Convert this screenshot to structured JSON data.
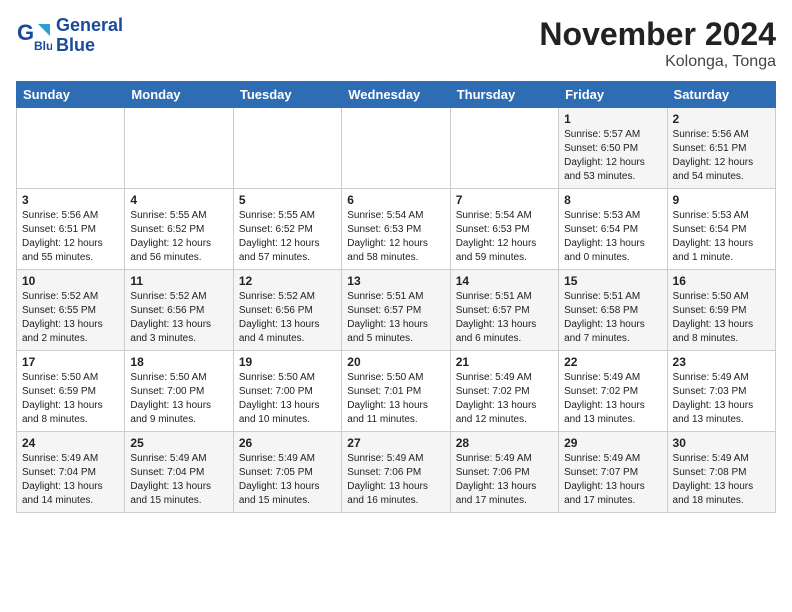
{
  "header": {
    "logo_line1": "General",
    "logo_line2": "Blue",
    "title": "November 2024",
    "subtitle": "Kolonga, Tonga"
  },
  "columns": [
    "Sunday",
    "Monday",
    "Tuesday",
    "Wednesday",
    "Thursday",
    "Friday",
    "Saturday"
  ],
  "rows": [
    [
      {
        "num": "",
        "info": ""
      },
      {
        "num": "",
        "info": ""
      },
      {
        "num": "",
        "info": ""
      },
      {
        "num": "",
        "info": ""
      },
      {
        "num": "",
        "info": ""
      },
      {
        "num": "1",
        "info": "Sunrise: 5:57 AM\nSunset: 6:50 PM\nDaylight: 12 hours and 53 minutes."
      },
      {
        "num": "2",
        "info": "Sunrise: 5:56 AM\nSunset: 6:51 PM\nDaylight: 12 hours and 54 minutes."
      }
    ],
    [
      {
        "num": "3",
        "info": "Sunrise: 5:56 AM\nSunset: 6:51 PM\nDaylight: 12 hours and 55 minutes."
      },
      {
        "num": "4",
        "info": "Sunrise: 5:55 AM\nSunset: 6:52 PM\nDaylight: 12 hours and 56 minutes."
      },
      {
        "num": "5",
        "info": "Sunrise: 5:55 AM\nSunset: 6:52 PM\nDaylight: 12 hours and 57 minutes."
      },
      {
        "num": "6",
        "info": "Sunrise: 5:54 AM\nSunset: 6:53 PM\nDaylight: 12 hours and 58 minutes."
      },
      {
        "num": "7",
        "info": "Sunrise: 5:54 AM\nSunset: 6:53 PM\nDaylight: 12 hours and 59 minutes."
      },
      {
        "num": "8",
        "info": "Sunrise: 5:53 AM\nSunset: 6:54 PM\nDaylight: 13 hours and 0 minutes."
      },
      {
        "num": "9",
        "info": "Sunrise: 5:53 AM\nSunset: 6:54 PM\nDaylight: 13 hours and 1 minute."
      }
    ],
    [
      {
        "num": "10",
        "info": "Sunrise: 5:52 AM\nSunset: 6:55 PM\nDaylight: 13 hours and 2 minutes."
      },
      {
        "num": "11",
        "info": "Sunrise: 5:52 AM\nSunset: 6:56 PM\nDaylight: 13 hours and 3 minutes."
      },
      {
        "num": "12",
        "info": "Sunrise: 5:52 AM\nSunset: 6:56 PM\nDaylight: 13 hours and 4 minutes."
      },
      {
        "num": "13",
        "info": "Sunrise: 5:51 AM\nSunset: 6:57 PM\nDaylight: 13 hours and 5 minutes."
      },
      {
        "num": "14",
        "info": "Sunrise: 5:51 AM\nSunset: 6:57 PM\nDaylight: 13 hours and 6 minutes."
      },
      {
        "num": "15",
        "info": "Sunrise: 5:51 AM\nSunset: 6:58 PM\nDaylight: 13 hours and 7 minutes."
      },
      {
        "num": "16",
        "info": "Sunrise: 5:50 AM\nSunset: 6:59 PM\nDaylight: 13 hours and 8 minutes."
      }
    ],
    [
      {
        "num": "17",
        "info": "Sunrise: 5:50 AM\nSunset: 6:59 PM\nDaylight: 13 hours and 8 minutes."
      },
      {
        "num": "18",
        "info": "Sunrise: 5:50 AM\nSunset: 7:00 PM\nDaylight: 13 hours and 9 minutes."
      },
      {
        "num": "19",
        "info": "Sunrise: 5:50 AM\nSunset: 7:00 PM\nDaylight: 13 hours and 10 minutes."
      },
      {
        "num": "20",
        "info": "Sunrise: 5:50 AM\nSunset: 7:01 PM\nDaylight: 13 hours and 11 minutes."
      },
      {
        "num": "21",
        "info": "Sunrise: 5:49 AM\nSunset: 7:02 PM\nDaylight: 13 hours and 12 minutes."
      },
      {
        "num": "22",
        "info": "Sunrise: 5:49 AM\nSunset: 7:02 PM\nDaylight: 13 hours and 13 minutes."
      },
      {
        "num": "23",
        "info": "Sunrise: 5:49 AM\nSunset: 7:03 PM\nDaylight: 13 hours and 13 minutes."
      }
    ],
    [
      {
        "num": "24",
        "info": "Sunrise: 5:49 AM\nSunset: 7:04 PM\nDaylight: 13 hours and 14 minutes."
      },
      {
        "num": "25",
        "info": "Sunrise: 5:49 AM\nSunset: 7:04 PM\nDaylight: 13 hours and 15 minutes."
      },
      {
        "num": "26",
        "info": "Sunrise: 5:49 AM\nSunset: 7:05 PM\nDaylight: 13 hours and 15 minutes."
      },
      {
        "num": "27",
        "info": "Sunrise: 5:49 AM\nSunset: 7:06 PM\nDaylight: 13 hours and 16 minutes."
      },
      {
        "num": "28",
        "info": "Sunrise: 5:49 AM\nSunset: 7:06 PM\nDaylight: 13 hours and 17 minutes."
      },
      {
        "num": "29",
        "info": "Sunrise: 5:49 AM\nSunset: 7:07 PM\nDaylight: 13 hours and 17 minutes."
      },
      {
        "num": "30",
        "info": "Sunrise: 5:49 AM\nSunset: 7:08 PM\nDaylight: 13 hours and 18 minutes."
      }
    ]
  ]
}
